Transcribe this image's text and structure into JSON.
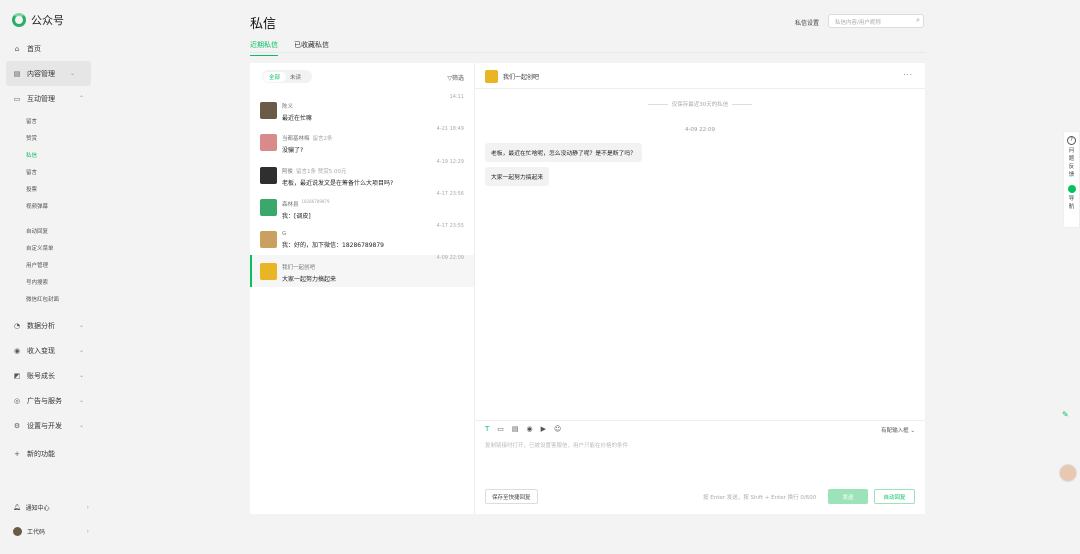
{
  "app": {
    "name": "公众号"
  },
  "nav": {
    "home": "首页",
    "content": "内容管理",
    "interaction": "互动管理",
    "sub_items": [
      "留言",
      "赞赏",
      "私信",
      "留言",
      "投票",
      "视频弹幕",
      "自动回复",
      "自定义菜单",
      "用户管理",
      "号内搜索",
      "微信红包封面"
    ],
    "sub_active_index": 2,
    "groups": [
      "数据分析",
      "收入变现",
      "账号成长",
      "广告与服务",
      "设置与开发",
      "新的功能"
    ],
    "notification": "通知中心",
    "account": "工代码"
  },
  "header": {
    "title": "私信",
    "privacy_settings": "私信设置",
    "search_placeholder": "私信内容/用户昵称"
  },
  "tabs": [
    "近期私信",
    "已收藏私信"
  ],
  "filter": {
    "all": "全部",
    "unread": "未读",
    "filter_btn": "筛选"
  },
  "conversations": [
    {
      "name": "陈义",
      "ext": "",
      "msg": "最近在忙嘛",
      "time": "14:11",
      "avatar": "#6b5a48"
    },
    {
      "name": "当都基林梅",
      "ext": "留言2条",
      "msg": "没骗了?",
      "time": "4-21 18:49",
      "avatar": "#d98b8b"
    },
    {
      "name": "阿俊",
      "ext": "留言1条 赞赏5.00元",
      "msg": "老板，最近说发文是在筹备什么大项目吗?",
      "time": "4-19 12:29",
      "avatar": "#2f2f2f"
    },
    {
      "name": "森林县",
      "ext": "18286789879",
      "msg": "我：[调皮]",
      "time": "4-17 23:56",
      "avatar": "#3aa86a"
    },
    {
      "name": "G",
      "ext": "",
      "msg": "我：好的，加下微信：18286789879",
      "time": "4-17 23:55",
      "avatar": "#c9a060"
    },
    {
      "name": "我们一起创吧",
      "ext": "",
      "msg": "大家一起努力搞起来",
      "time": "4-09 22:09",
      "avatar": "#e8b624"
    }
  ],
  "chat": {
    "title": "我们一起创吧",
    "more": "···",
    "notice": "仅保存最近30天的私信",
    "time": "4-09 22:09",
    "messages": [
      "老板，最近在忙啥呢，怎么没动静了呢？是不是断了吗？",
      "大家一起努力搞起来"
    ],
    "lang": "有配输入框",
    "placeholder": "复制链接时打开，已被设置客服信，用户只能在价格的条件",
    "quick_reply": "保存至快捷回复",
    "hint": "按 Enter 发送，按 Shift + Enter 换行 0/600",
    "send": "发送",
    "auto_reply": "自动回复"
  },
  "float": {
    "help": "问题反馈",
    "guide": "导航"
  }
}
